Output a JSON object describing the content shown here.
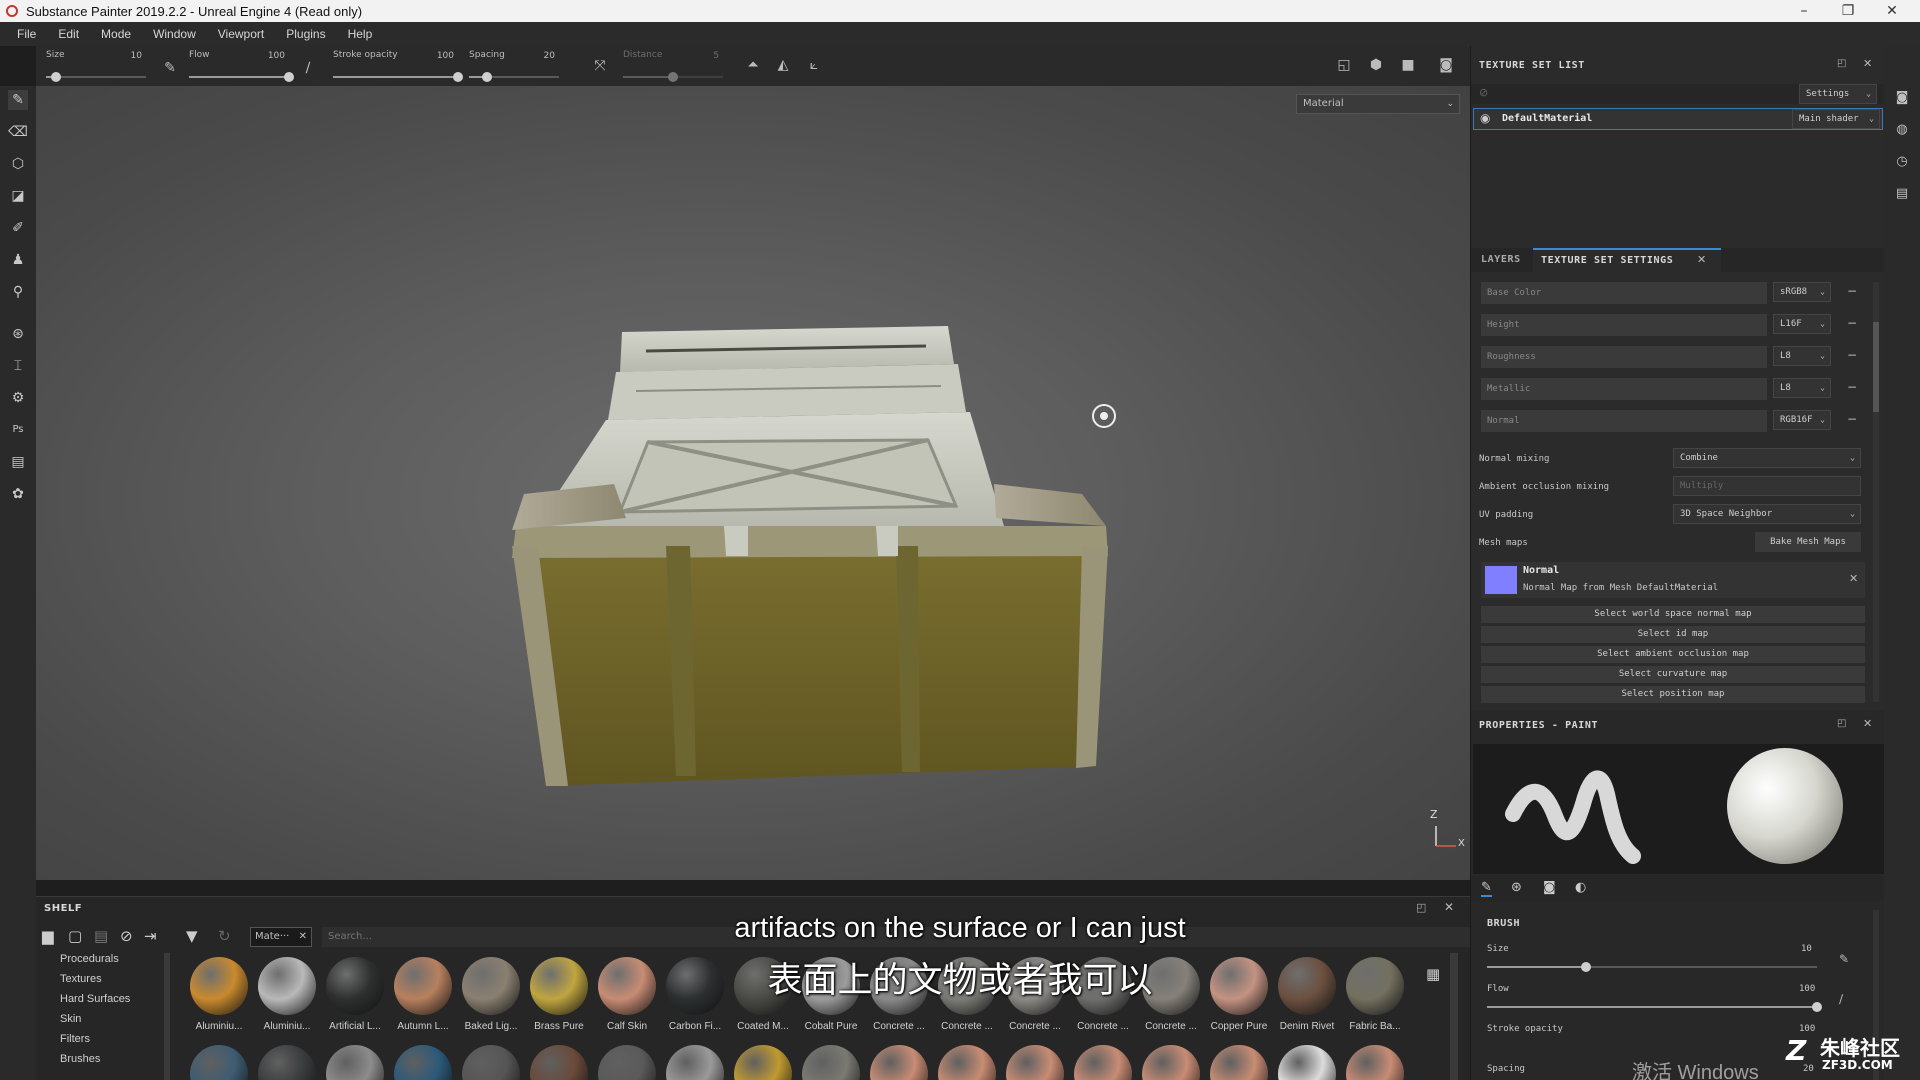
{
  "window": {
    "title": "Substance Painter 2019.2.2 - Unreal Engine 4 (Read only)",
    "buttons": [
      "–",
      "❐",
      "✕"
    ]
  },
  "menu": [
    "File",
    "Edit",
    "Mode",
    "Window",
    "Viewport",
    "Plugins",
    "Help"
  ],
  "tool_options": {
    "size": {
      "label": "Size",
      "value": "10",
      "level": 0.1
    },
    "flow": {
      "label": "Flow",
      "value": "100",
      "level": 1.0
    },
    "stroke_opacity": {
      "label": "Stroke opacity",
      "value": "100",
      "level": 1.0
    },
    "spacing": {
      "label": "Spacing",
      "value": "20",
      "level": 0.2
    },
    "distance": {
      "label": "Distance",
      "value": "5",
      "level": 0.5
    }
  },
  "viewport": {
    "display_mode": "Material",
    "axis": {
      "z": "Z",
      "x": "X"
    }
  },
  "texture_set_list": {
    "title": "TEXTURE SET LIST",
    "settings_label": "Settings",
    "item": "DefaultMaterial",
    "shader": "Main shader"
  },
  "tabs": {
    "layers": "LAYERS",
    "texture_set_settings": "TEXTURE SET SETTINGS"
  },
  "channels": [
    {
      "name": "Base Color",
      "format": "sRGB8"
    },
    {
      "name": "Height",
      "format": "L16F"
    },
    {
      "name": "Roughness",
      "format": "L8"
    },
    {
      "name": "Metallic",
      "format": "L8"
    },
    {
      "name": "Normal",
      "format": "RGB16F"
    }
  ],
  "settings": {
    "normal_mixing": {
      "label": "Normal mixing",
      "value": "Combine"
    },
    "ao_mixing": {
      "label": "Ambient occlusion mixing",
      "value": "Multiply"
    },
    "uv_padding": {
      "label": "UV padding",
      "value": "3D Space Neighbor"
    },
    "mesh_maps": {
      "label": "Mesh maps",
      "bake": "Bake Mesh Maps"
    }
  },
  "normal_map": {
    "title": "Normal",
    "desc": "Normal Map from Mesh DefaultMaterial"
  },
  "map_buttons": [
    "Select world space normal map",
    "Select id map",
    "Select ambient occlusion map",
    "Select curvature map",
    "Select position map"
  ],
  "properties": {
    "title": "PROPERTIES - PAINT",
    "brush_header": "BRUSH",
    "size": {
      "label": "Size",
      "value": "10",
      "level": 0.3
    },
    "flow": {
      "label": "Flow",
      "value": "100",
      "level": 1.0
    },
    "stroke_opacity": {
      "label": "Stroke opacity",
      "value": "100"
    },
    "spacing": {
      "label": "Spacing",
      "value": "20"
    }
  },
  "shelf": {
    "title": "SHELF",
    "filter_chip": "Mate···",
    "search_placeholder": "Search...",
    "categories": [
      "Procedurals",
      "Textures",
      "Hard Surfaces",
      "Skin",
      "Filters",
      "Brushes"
    ],
    "materials": [
      {
        "name": "Aluminiu...",
        "color": "#c98a2e"
      },
      {
        "name": "Aluminiu...",
        "color": "#b9b9b9"
      },
      {
        "name": "Artificial L...",
        "color": "#2e2f2f"
      },
      {
        "name": "Autumn L...",
        "color": "#b8805e"
      },
      {
        "name": "Baked Lig...",
        "color": "#8a8070"
      },
      {
        "name": "Brass Pure",
        "color": "#c0a540"
      },
      {
        "name": "Calf Skin",
        "color": "#c88c74"
      },
      {
        "name": "Carbon Fi...",
        "color": "#2c2f30"
      },
      {
        "name": "Coated M...",
        "color": "#4a4a45"
      },
      {
        "name": "Cobalt Pure",
        "color": "#9c9c9c"
      },
      {
        "name": "Concrete ...",
        "color": "#8a8a8a"
      },
      {
        "name": "Concrete ...",
        "color": "#7c7c78"
      },
      {
        "name": "Concrete ...",
        "color": "#8c8a86"
      },
      {
        "name": "Concrete ...",
        "color": "#6f6f6d"
      },
      {
        "name": "Concrete ...",
        "color": "#85817a"
      },
      {
        "name": "Copper Pure",
        "color": "#c49382"
      },
      {
        "name": "Denim Rivet",
        "color": "#6b5040"
      },
      {
        "name": "Fabric Ba...",
        "color": "#737060"
      }
    ],
    "second_row_colors": [
      "#3e5c72",
      "#3a3d3e",
      "#8c8c8c",
      "#2b5a7a",
      "#555",
      "#6a4a3a",
      "#5a5a5a",
      "#9a9a9a",
      "#c09a30",
      "#7a7a72",
      "#c88c74",
      "#c88c74",
      "#c88c74",
      "#c88c74",
      "#c88c74",
      "#c88c74",
      "#dcdcdc",
      "#c88c74"
    ]
  },
  "subtitles": {
    "en": "artifacts on the surface or I can just",
    "zh": "表面上的文物或者我可以"
  },
  "watermarks": {
    "windows": "激活 Windows",
    "site_cn": "朱峰社区",
    "site_url": "ZF3D.COM"
  }
}
